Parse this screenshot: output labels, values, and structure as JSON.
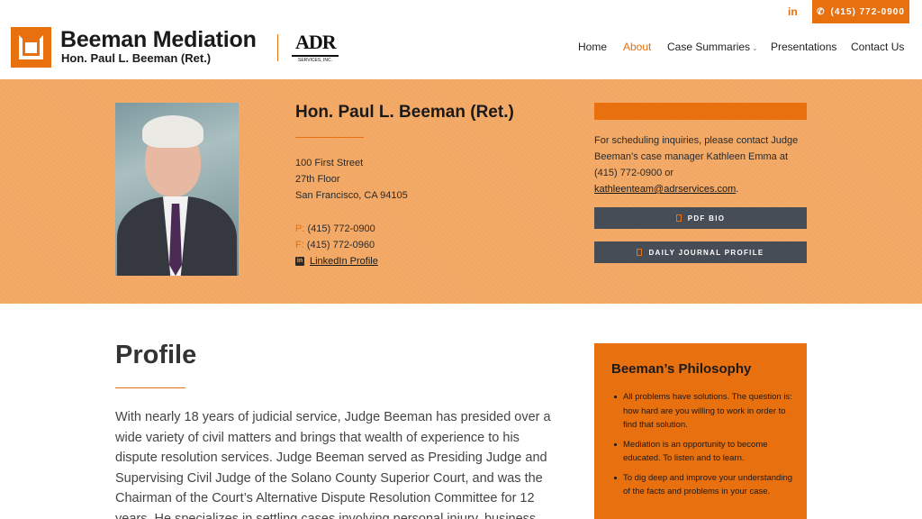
{
  "header": {
    "brand_title": "Beeman Mediation",
    "brand_subtitle": "Hon. Paul L. Beeman (Ret.)",
    "adr_logo": "ADR",
    "adr_logo_sub": "SERVICES, INC.",
    "linkedin_label": "in",
    "phone_label": "(415) 772-0900",
    "accent_color": "#e8700f"
  },
  "nav": {
    "items": [
      {
        "label": "Home"
      },
      {
        "label": "About"
      },
      {
        "label": "Case Summaries"
      },
      {
        "label": "Presentations"
      },
      {
        "label": "Contact Us"
      }
    ],
    "active": "About"
  },
  "hero": {
    "name": "Hon. Paul L. Beeman (Ret.)",
    "address_1": "100 First Street",
    "address_2": "27th Floor",
    "address_3": "San Francisco, CA 94105",
    "phone_label": "P:",
    "phone": "(415) 772-0900",
    "fax_label": "F:",
    "fax": "(415) 772-0960",
    "linkedin_link": "LinkedIn Profile",
    "schedule_text": "For scheduling inquiries, please contact Judge Beeman’s case manager Kathleen Emma at (415) 772-0900 or",
    "schedule_email": "kathleenteam@adrservices.com",
    "schedule_end": ".",
    "pdf_bio_button": "PDF BIO",
    "journal_button": "DAILY JOURNAL PROFILE"
  },
  "profile": {
    "title": "Profile",
    "text": "With nearly 18 years of judicial service, Judge Beeman has presided over a wide variety of civil matters and brings that wealth of experience to his dispute resolution services.  Judge Beeman served as Presiding Judge and Supervising Civil Judge of the Solano County Superior Court, and was the Chairman of the Court’s Alternative Dispute Resolution Committee for 12 years.  He specializes in settling cases involving personal injury, business"
  },
  "philosophy": {
    "title": "Beeman’s Philosophy",
    "items": [
      "All problems have solutions. The question is: how hard are you willing to work in order to find that solution.",
      "Mediation is an opportunity to become educated. To listen and to learn.",
      "To dig deep and improve your understanding of the facts and problems in your case."
    ]
  }
}
